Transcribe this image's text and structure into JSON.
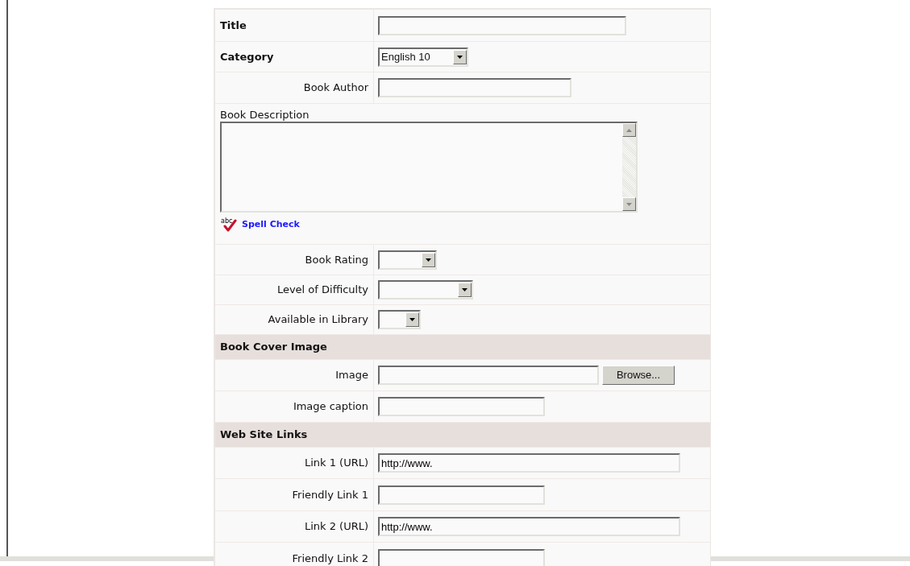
{
  "form": {
    "rows": [
      {
        "kind": "text",
        "label": "Title",
        "bold": true,
        "value": ""
      },
      {
        "kind": "select",
        "label": "Category",
        "bold": true,
        "value": "English 10"
      },
      {
        "kind": "text",
        "label": "Book Author",
        "bold": false,
        "value": ""
      },
      {
        "kind": "textarea",
        "label": "Book Description",
        "bold": false,
        "value": "",
        "spell_check_icon_text": "abc",
        "spell_check": "Spell Check"
      },
      {
        "kind": "select",
        "label": "Book Rating",
        "bold": false,
        "value": ""
      },
      {
        "kind": "select",
        "label": "Level of Difficulty",
        "bold": false,
        "value": ""
      },
      {
        "kind": "select",
        "label": "Available in Library",
        "bold": false,
        "value": ""
      },
      {
        "kind": "section",
        "label": "Book Cover Image"
      },
      {
        "kind": "file",
        "label": "Image",
        "bold": false,
        "value": "",
        "button": "Browse..."
      },
      {
        "kind": "text",
        "label": "Image caption",
        "bold": false,
        "value": ""
      },
      {
        "kind": "section",
        "label": "Web Site Links"
      },
      {
        "kind": "text",
        "label": "Link 1 (URL)",
        "bold": false,
        "value": "http://www."
      },
      {
        "kind": "text",
        "label": "Friendly Link 1",
        "bold": false,
        "value": ""
      },
      {
        "kind": "text",
        "label": "Link 2 (URL)",
        "bold": false,
        "value": "http://www."
      },
      {
        "kind": "text",
        "label": "Friendly Link 2",
        "bold": false,
        "value": ""
      }
    ]
  }
}
